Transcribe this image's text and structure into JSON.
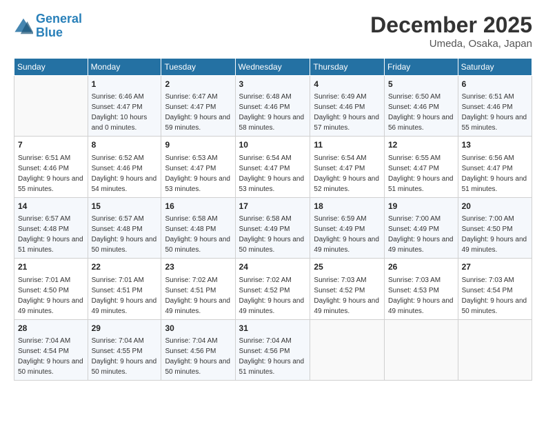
{
  "header": {
    "logo_line1": "General",
    "logo_line2": "Blue",
    "month": "December 2025",
    "location": "Umeda, Osaka, Japan"
  },
  "days_of_week": [
    "Sunday",
    "Monday",
    "Tuesday",
    "Wednesday",
    "Thursday",
    "Friday",
    "Saturday"
  ],
  "weeks": [
    [
      {
        "day": "",
        "sunrise": "",
        "sunset": "",
        "daylight": ""
      },
      {
        "day": "1",
        "sunrise": "Sunrise: 6:46 AM",
        "sunset": "Sunset: 4:47 PM",
        "daylight": "Daylight: 10 hours and 0 minutes."
      },
      {
        "day": "2",
        "sunrise": "Sunrise: 6:47 AM",
        "sunset": "Sunset: 4:47 PM",
        "daylight": "Daylight: 9 hours and 59 minutes."
      },
      {
        "day": "3",
        "sunrise": "Sunrise: 6:48 AM",
        "sunset": "Sunset: 4:46 PM",
        "daylight": "Daylight: 9 hours and 58 minutes."
      },
      {
        "day": "4",
        "sunrise": "Sunrise: 6:49 AM",
        "sunset": "Sunset: 4:46 PM",
        "daylight": "Daylight: 9 hours and 57 minutes."
      },
      {
        "day": "5",
        "sunrise": "Sunrise: 6:50 AM",
        "sunset": "Sunset: 4:46 PM",
        "daylight": "Daylight: 9 hours and 56 minutes."
      },
      {
        "day": "6",
        "sunrise": "Sunrise: 6:51 AM",
        "sunset": "Sunset: 4:46 PM",
        "daylight": "Daylight: 9 hours and 55 minutes."
      }
    ],
    [
      {
        "day": "7",
        "sunrise": "Sunrise: 6:51 AM",
        "sunset": "Sunset: 4:46 PM",
        "daylight": "Daylight: 9 hours and 55 minutes."
      },
      {
        "day": "8",
        "sunrise": "Sunrise: 6:52 AM",
        "sunset": "Sunset: 4:46 PM",
        "daylight": "Daylight: 9 hours and 54 minutes."
      },
      {
        "day": "9",
        "sunrise": "Sunrise: 6:53 AM",
        "sunset": "Sunset: 4:47 PM",
        "daylight": "Daylight: 9 hours and 53 minutes."
      },
      {
        "day": "10",
        "sunrise": "Sunrise: 6:54 AM",
        "sunset": "Sunset: 4:47 PM",
        "daylight": "Daylight: 9 hours and 53 minutes."
      },
      {
        "day": "11",
        "sunrise": "Sunrise: 6:54 AM",
        "sunset": "Sunset: 4:47 PM",
        "daylight": "Daylight: 9 hours and 52 minutes."
      },
      {
        "day": "12",
        "sunrise": "Sunrise: 6:55 AM",
        "sunset": "Sunset: 4:47 PM",
        "daylight": "Daylight: 9 hours and 51 minutes."
      },
      {
        "day": "13",
        "sunrise": "Sunrise: 6:56 AM",
        "sunset": "Sunset: 4:47 PM",
        "daylight": "Daylight: 9 hours and 51 minutes."
      }
    ],
    [
      {
        "day": "14",
        "sunrise": "Sunrise: 6:57 AM",
        "sunset": "Sunset: 4:48 PM",
        "daylight": "Daylight: 9 hours and 51 minutes."
      },
      {
        "day": "15",
        "sunrise": "Sunrise: 6:57 AM",
        "sunset": "Sunset: 4:48 PM",
        "daylight": "Daylight: 9 hours and 50 minutes."
      },
      {
        "day": "16",
        "sunrise": "Sunrise: 6:58 AM",
        "sunset": "Sunset: 4:48 PM",
        "daylight": "Daylight: 9 hours and 50 minutes."
      },
      {
        "day": "17",
        "sunrise": "Sunrise: 6:58 AM",
        "sunset": "Sunset: 4:49 PM",
        "daylight": "Daylight: 9 hours and 50 minutes."
      },
      {
        "day": "18",
        "sunrise": "Sunrise: 6:59 AM",
        "sunset": "Sunset: 4:49 PM",
        "daylight": "Daylight: 9 hours and 49 minutes."
      },
      {
        "day": "19",
        "sunrise": "Sunrise: 7:00 AM",
        "sunset": "Sunset: 4:49 PM",
        "daylight": "Daylight: 9 hours and 49 minutes."
      },
      {
        "day": "20",
        "sunrise": "Sunrise: 7:00 AM",
        "sunset": "Sunset: 4:50 PM",
        "daylight": "Daylight: 9 hours and 49 minutes."
      }
    ],
    [
      {
        "day": "21",
        "sunrise": "Sunrise: 7:01 AM",
        "sunset": "Sunset: 4:50 PM",
        "daylight": "Daylight: 9 hours and 49 minutes."
      },
      {
        "day": "22",
        "sunrise": "Sunrise: 7:01 AM",
        "sunset": "Sunset: 4:51 PM",
        "daylight": "Daylight: 9 hours and 49 minutes."
      },
      {
        "day": "23",
        "sunrise": "Sunrise: 7:02 AM",
        "sunset": "Sunset: 4:51 PM",
        "daylight": "Daylight: 9 hours and 49 minutes."
      },
      {
        "day": "24",
        "sunrise": "Sunrise: 7:02 AM",
        "sunset": "Sunset: 4:52 PM",
        "daylight": "Daylight: 9 hours and 49 minutes."
      },
      {
        "day": "25",
        "sunrise": "Sunrise: 7:03 AM",
        "sunset": "Sunset: 4:52 PM",
        "daylight": "Daylight: 9 hours and 49 minutes."
      },
      {
        "day": "26",
        "sunrise": "Sunrise: 7:03 AM",
        "sunset": "Sunset: 4:53 PM",
        "daylight": "Daylight: 9 hours and 49 minutes."
      },
      {
        "day": "27",
        "sunrise": "Sunrise: 7:03 AM",
        "sunset": "Sunset: 4:54 PM",
        "daylight": "Daylight: 9 hours and 50 minutes."
      }
    ],
    [
      {
        "day": "28",
        "sunrise": "Sunrise: 7:04 AM",
        "sunset": "Sunset: 4:54 PM",
        "daylight": "Daylight: 9 hours and 50 minutes."
      },
      {
        "day": "29",
        "sunrise": "Sunrise: 7:04 AM",
        "sunset": "Sunset: 4:55 PM",
        "daylight": "Daylight: 9 hours and 50 minutes."
      },
      {
        "day": "30",
        "sunrise": "Sunrise: 7:04 AM",
        "sunset": "Sunset: 4:56 PM",
        "daylight": "Daylight: 9 hours and 50 minutes."
      },
      {
        "day": "31",
        "sunrise": "Sunrise: 7:04 AM",
        "sunset": "Sunset: 4:56 PM",
        "daylight": "Daylight: 9 hours and 51 minutes."
      },
      {
        "day": "",
        "sunrise": "",
        "sunset": "",
        "daylight": ""
      },
      {
        "day": "",
        "sunrise": "",
        "sunset": "",
        "daylight": ""
      },
      {
        "day": "",
        "sunrise": "",
        "sunset": "",
        "daylight": ""
      }
    ]
  ]
}
